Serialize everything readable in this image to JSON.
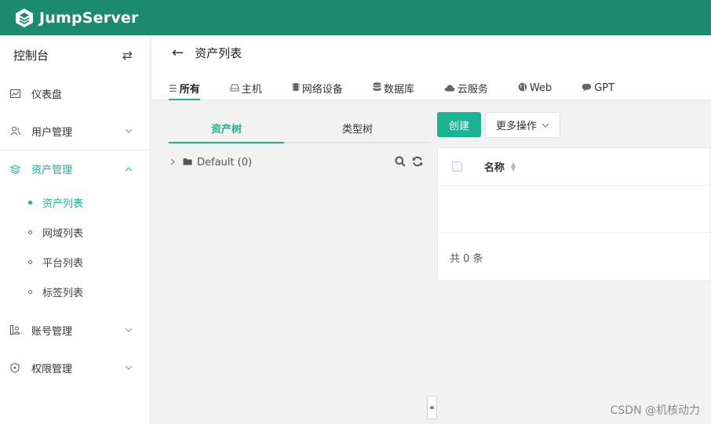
{
  "app": {
    "name": "JumpServer",
    "brand_color": "#1b8a6f",
    "accent_color": "#1ab394"
  },
  "sidebar": {
    "header": "控制台",
    "switch_icon": "swap-icon",
    "items": [
      {
        "label": "仪表盘",
        "icon": "dashboard-icon"
      },
      {
        "label": "用户管理",
        "icon": "users-icon"
      },
      {
        "label": "资产管理",
        "icon": "layers-icon"
      },
      {
        "label": "账号管理",
        "icon": "account-icon"
      },
      {
        "label": "权限管理",
        "icon": "shield-icon"
      }
    ],
    "asset_sub_items": [
      {
        "label": "资产列表"
      },
      {
        "label": "网域列表"
      },
      {
        "label": "平台列表"
      },
      {
        "label": "标签列表"
      }
    ]
  },
  "page": {
    "title": "资产列表",
    "tabs": [
      {
        "label": "所有",
        "icon": "list-icon"
      },
      {
        "label": "主机",
        "icon": "host-icon"
      },
      {
        "label": "网络设备",
        "icon": "chip-icon"
      },
      {
        "label": "数据库",
        "icon": "database-icon"
      },
      {
        "label": "云服务",
        "icon": "cloud-icon"
      },
      {
        "label": "Web",
        "icon": "globe-icon"
      },
      {
        "label": "GPT",
        "icon": "chat-icon"
      }
    ]
  },
  "tree": {
    "tabs": [
      "资产树",
      "类型树"
    ],
    "root_node": "Default (0)"
  },
  "toolbar": {
    "create_label": "创建",
    "more_label": "更多操作"
  },
  "table": {
    "column_name": "名称",
    "total_text": "共 0 条"
  },
  "watermark": "CSDN @机核动力"
}
